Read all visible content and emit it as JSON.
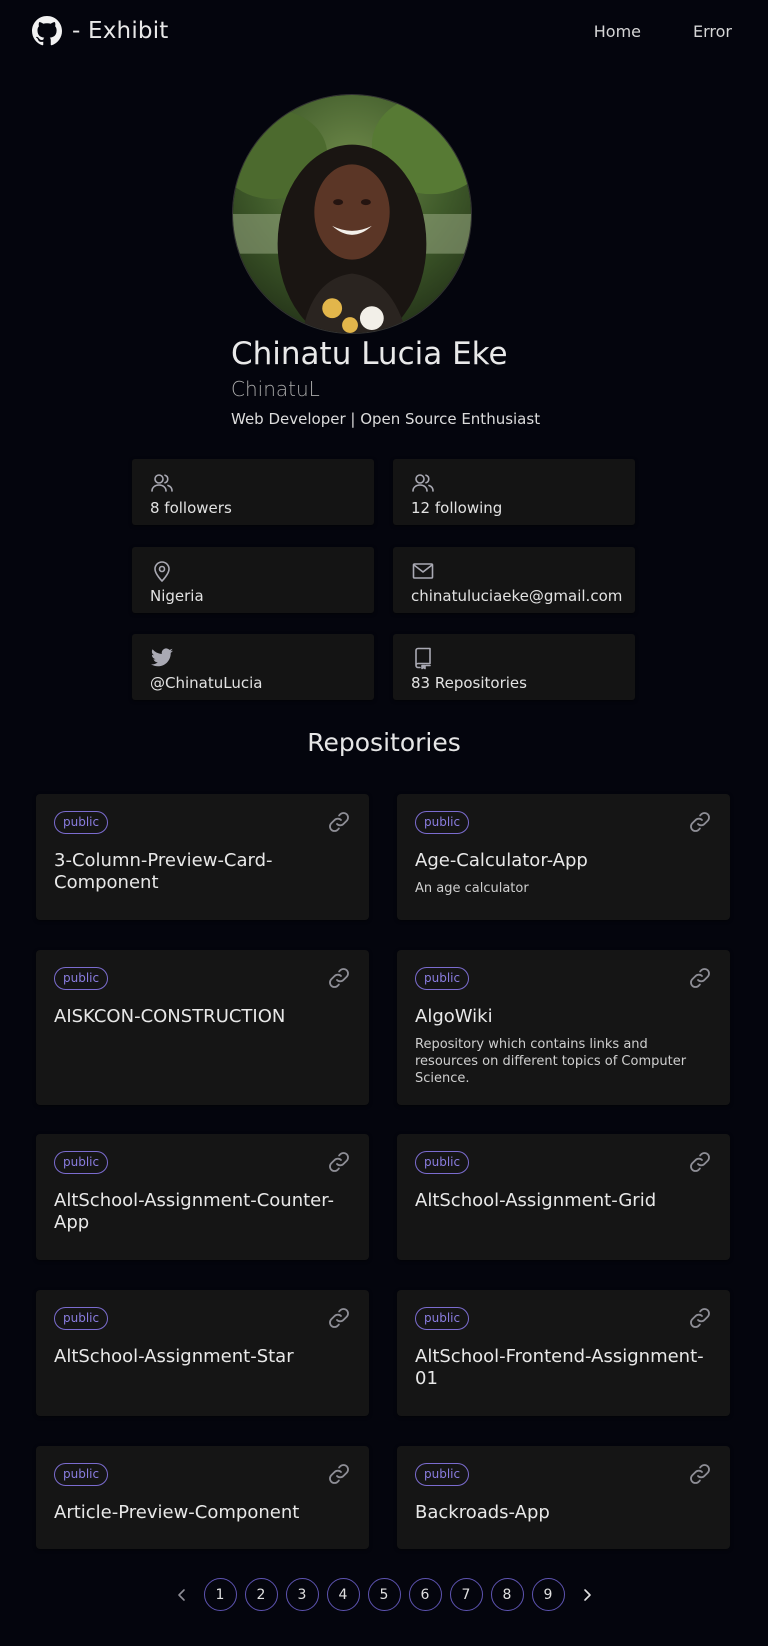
{
  "header": {
    "title": "- Exhibit",
    "nav": [
      {
        "label": "Home"
      },
      {
        "label": "Error"
      }
    ]
  },
  "profile": {
    "name": "Chinatu Lucia Eke",
    "username": "ChinatuL",
    "bio": "Web Developer | Open Source Enthusiast"
  },
  "stats": {
    "followers": "8 followers",
    "following": "12 following",
    "location": "Nigeria",
    "email": "chinatuluciaeke@gmail.com",
    "twitter": "@ChinatuLucia",
    "repositories": "83 Repositories"
  },
  "repositories_section": {
    "title": "Repositories"
  },
  "repos": [
    {
      "visibility": "public",
      "name": "3-Column-Preview-Card-Component",
      "description": ""
    },
    {
      "visibility": "public",
      "name": "Age-Calculator-App",
      "description": "An age calculator"
    },
    {
      "visibility": "public",
      "name": "AISKCON-CONSTRUCTION",
      "description": ""
    },
    {
      "visibility": "public",
      "name": "AlgoWiki",
      "description": "Repository which contains links and resources on different topics of Computer Science."
    },
    {
      "visibility": "public",
      "name": "AltSchool-Assignment-Counter-App",
      "description": ""
    },
    {
      "visibility": "public",
      "name": "AltSchool-Assignment-Grid",
      "description": ""
    },
    {
      "visibility": "public",
      "name": "AltSchool-Assignment-Star",
      "description": ""
    },
    {
      "visibility": "public",
      "name": "AltSchool-Frontend-Assignment-01",
      "description": ""
    },
    {
      "visibility": "public",
      "name": "Article-Preview-Component",
      "description": ""
    },
    {
      "visibility": "public",
      "name": "Backroads-App",
      "description": ""
    }
  ],
  "pagination": {
    "pages": [
      "1",
      "2",
      "3",
      "4",
      "5",
      "6",
      "7",
      "8",
      "9"
    ]
  },
  "colors": {
    "background": "#04050d",
    "card": "#151515",
    "accent": "#7b6ccf",
    "icon": "#a9a9b3"
  },
  "icons": {
    "brand": "github-icon",
    "followers": "users-icon",
    "following": "users-icon",
    "location": "map-pin-icon",
    "email": "mail-icon",
    "twitter": "twitter-icon",
    "repositories": "repo-icon",
    "repo_link": "link-icon",
    "prev": "chevron-left-icon",
    "next": "chevron-right-icon"
  }
}
